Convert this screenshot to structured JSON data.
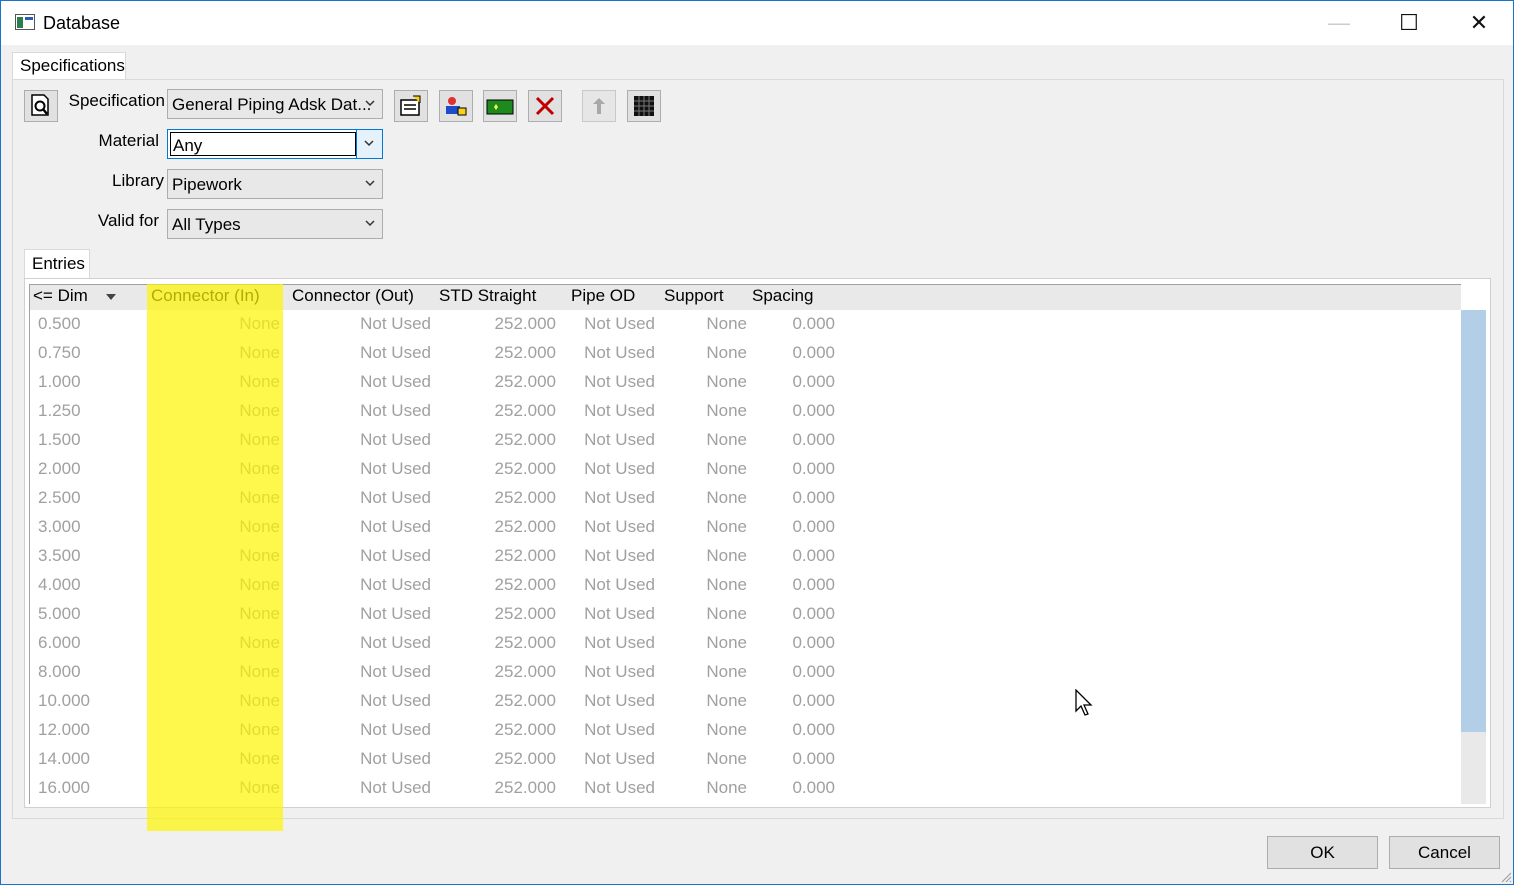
{
  "window": {
    "title": "Database",
    "controls": {
      "minimize": "—",
      "maximize": "☐",
      "close": "✕"
    }
  },
  "tabs": {
    "specifications": "Specifications",
    "entries": "Entries"
  },
  "form": {
    "specification_label": "Specification",
    "specification_value": "General Piping Adsk Dat...",
    "material_label": "Material",
    "material_value": "Any",
    "library_label": "Library",
    "library_value": "Pipework",
    "valid_for_label": "Valid for",
    "valid_for_value": "All Types"
  },
  "toolbar": {
    "icons": [
      "preview-icon",
      "properties-icon",
      "user-icon",
      "add-green-icon",
      "delete-red-x-icon",
      "pin-icon",
      "grid-icon"
    ],
    "accent_colors": {
      "delete": "#c00000",
      "add": "#1e8a1e",
      "user": "#1e4cc8"
    }
  },
  "grid": {
    "headers": {
      "dim": "<= Dim",
      "connector_in": "Connector (In)",
      "connector_out": "Connector (Out)",
      "std_straight": "STD Straight",
      "pipe_od": "Pipe OD",
      "support": "Support",
      "spacing": "Spacing"
    },
    "rows": [
      {
        "dim": "0.500",
        "connector_in": "None",
        "connector_out": "Not Used",
        "std_straight": "252.000",
        "pipe_od": "Not Used",
        "support": "None",
        "spacing": "0.000"
      },
      {
        "dim": "0.750",
        "connector_in": "None",
        "connector_out": "Not Used",
        "std_straight": "252.000",
        "pipe_od": "Not Used",
        "support": "None",
        "spacing": "0.000"
      },
      {
        "dim": "1.000",
        "connector_in": "None",
        "connector_out": "Not Used",
        "std_straight": "252.000",
        "pipe_od": "Not Used",
        "support": "None",
        "spacing": "0.000"
      },
      {
        "dim": "1.250",
        "connector_in": "None",
        "connector_out": "Not Used",
        "std_straight": "252.000",
        "pipe_od": "Not Used",
        "support": "None",
        "spacing": "0.000"
      },
      {
        "dim": "1.500",
        "connector_in": "None",
        "connector_out": "Not Used",
        "std_straight": "252.000",
        "pipe_od": "Not Used",
        "support": "None",
        "spacing": "0.000"
      },
      {
        "dim": "2.000",
        "connector_in": "None",
        "connector_out": "Not Used",
        "std_straight": "252.000",
        "pipe_od": "Not Used",
        "support": "None",
        "spacing": "0.000"
      },
      {
        "dim": "2.500",
        "connector_in": "None",
        "connector_out": "Not Used",
        "std_straight": "252.000",
        "pipe_od": "Not Used",
        "support": "None",
        "spacing": "0.000"
      },
      {
        "dim": "3.000",
        "connector_in": "None",
        "connector_out": "Not Used",
        "std_straight": "252.000",
        "pipe_od": "Not Used",
        "support": "None",
        "spacing": "0.000"
      },
      {
        "dim": "3.500",
        "connector_in": "None",
        "connector_out": "Not Used",
        "std_straight": "252.000",
        "pipe_od": "Not Used",
        "support": "None",
        "spacing": "0.000"
      },
      {
        "dim": "4.000",
        "connector_in": "None",
        "connector_out": "Not Used",
        "std_straight": "252.000",
        "pipe_od": "Not Used",
        "support": "None",
        "spacing": "0.000"
      },
      {
        "dim": "5.000",
        "connector_in": "None",
        "connector_out": "Not Used",
        "std_straight": "252.000",
        "pipe_od": "Not Used",
        "support": "None",
        "spacing": "0.000"
      },
      {
        "dim": "6.000",
        "connector_in": "None",
        "connector_out": "Not Used",
        "std_straight": "252.000",
        "pipe_od": "Not Used",
        "support": "None",
        "spacing": "0.000"
      },
      {
        "dim": "8.000",
        "connector_in": "None",
        "connector_out": "Not Used",
        "std_straight": "252.000",
        "pipe_od": "Not Used",
        "support": "None",
        "spacing": "0.000"
      },
      {
        "dim": "10.000",
        "connector_in": "None",
        "connector_out": "Not Used",
        "std_straight": "252.000",
        "pipe_od": "Not Used",
        "support": "None",
        "spacing": "0.000"
      },
      {
        "dim": "12.000",
        "connector_in": "None",
        "connector_out": "Not Used",
        "std_straight": "252.000",
        "pipe_od": "Not Used",
        "support": "None",
        "spacing": "0.000"
      },
      {
        "dim": "14.000",
        "connector_in": "None",
        "connector_out": "Not Used",
        "std_straight": "252.000",
        "pipe_od": "Not Used",
        "support": "None",
        "spacing": "0.000"
      },
      {
        "dim": "16.000",
        "connector_in": "None",
        "connector_out": "Not Used",
        "std_straight": "252.000",
        "pipe_od": "Not Used",
        "support": "None",
        "spacing": "0.000"
      }
    ],
    "text_color": "#a0a0a0",
    "highlight_color": "#fff500"
  },
  "buttons": {
    "ok": "OK",
    "cancel": "Cancel"
  }
}
